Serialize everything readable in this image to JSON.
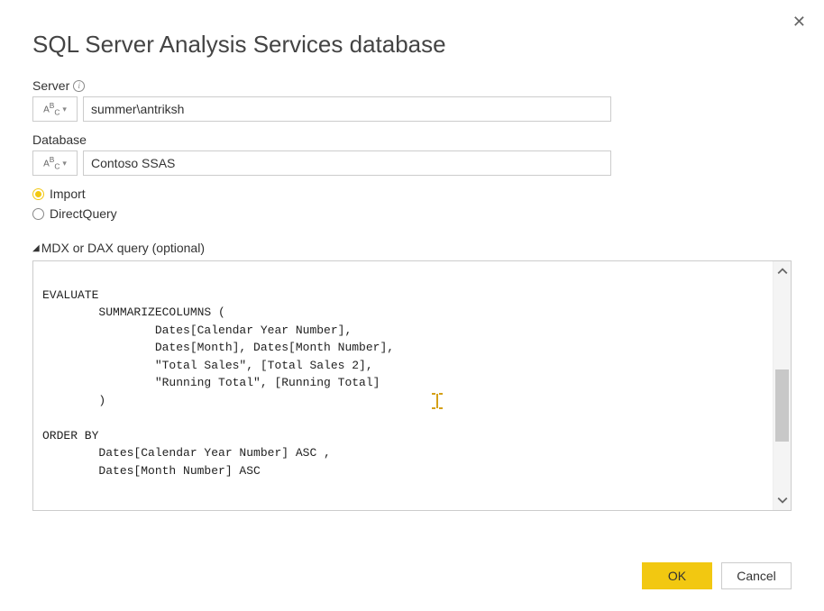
{
  "dialog": {
    "title": "SQL Server Analysis Services database",
    "close": "✕"
  },
  "fields": {
    "server": {
      "label": "Server",
      "type_indicator": "ABC",
      "value": "summer\\antriksh"
    },
    "database": {
      "label": "Database",
      "type_indicator": "ABC",
      "value": "Contoso SSAS"
    }
  },
  "mode": {
    "import": "Import",
    "directquery": "DirectQuery",
    "selected": "import"
  },
  "querySection": {
    "label": "MDX or DAX query (optional)",
    "text": "\nEVALUATE\n        SUMMARIZECOLUMNS (\n                Dates[Calendar Year Number],\n                Dates[Month], Dates[Month Number],\n                \"Total Sales\", [Total Sales 2],\n                \"Running Total\", [Running Total]\n        )\n\nORDER BY\n        Dates[Calendar Year Number] ASC ,\n        Dates[Month Number] ASC"
  },
  "buttons": {
    "ok": "OK",
    "cancel": "Cancel"
  }
}
